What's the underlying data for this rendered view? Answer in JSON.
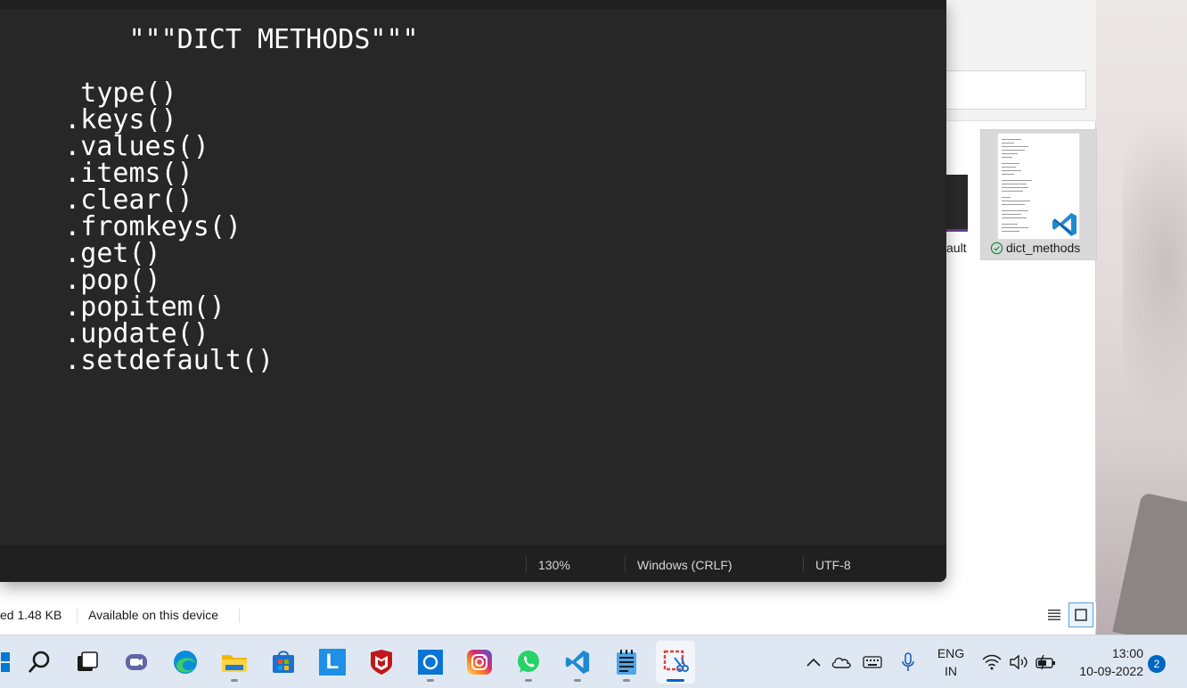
{
  "notepad": {
    "lines": [
      "        \"\"\"DICT METHODS\"\"\"",
      "",
      "     type()",
      "    .keys()",
      "    .values()",
      "    .items()",
      "    .clear()",
      "    .fromkeys()",
      "    .get()",
      "    .pop()",
      "    .popitem()",
      "    .update()",
      "    .setdefault()"
    ],
    "status": {
      "zoom": "130%",
      "line_ending": "Windows (CRLF)",
      "encoding": "UTF-8"
    }
  },
  "explorer": {
    "partial_file_label": "ault",
    "selected_file": {
      "name": "dict_methods",
      "sync_status_icon": "check-circle-icon",
      "badge_icon": "vscode-icon"
    },
    "status_bar": {
      "size_text": "ed  1.48 KB",
      "availability": "Available on this device"
    },
    "view_buttons": [
      "details-view-icon",
      "tiles-view-icon"
    ]
  },
  "taskbar": {
    "apps": [
      {
        "name": "start",
        "icon": "windows-icon"
      },
      {
        "name": "search",
        "icon": "search-icon"
      },
      {
        "name": "task-view",
        "icon": "task-view-icon"
      },
      {
        "name": "chat",
        "icon": "teams-chat-icon"
      },
      {
        "name": "edge",
        "icon": "edge-icon"
      },
      {
        "name": "file-explorer",
        "icon": "folder-icon"
      },
      {
        "name": "store",
        "icon": "store-icon"
      },
      {
        "name": "l-app",
        "icon": "l-app-icon",
        "label": "L"
      },
      {
        "name": "mcafee",
        "icon": "mcafee-icon"
      },
      {
        "name": "cortana",
        "icon": "cortana-icon"
      },
      {
        "name": "instagram",
        "icon": "instagram-icon"
      },
      {
        "name": "whatsapp",
        "icon": "whatsapp-icon"
      },
      {
        "name": "vscode",
        "icon": "vscode-icon"
      },
      {
        "name": "notepad",
        "icon": "notepad-icon"
      },
      {
        "name": "snipping-tool",
        "icon": "snipping-tool-icon"
      }
    ],
    "tray": {
      "language_line1": "ENG",
      "language_line2": "IN",
      "time": "13:00",
      "date": "10-09-2022",
      "notification_count": "2"
    },
    "colors": {
      "accent": "#0067c0",
      "taskbar_bg": "#dfe8f2",
      "editor_bg": "#272727"
    }
  }
}
